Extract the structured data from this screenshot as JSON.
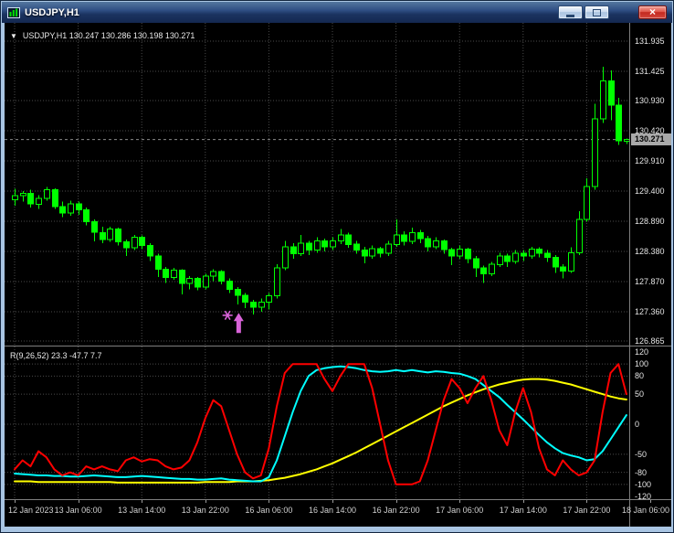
{
  "window": {
    "title": "USDJPY,H1",
    "close_glyph": "×"
  },
  "chart": {
    "dropdown_glyph": "▼",
    "symbol_line": "USDJPY,H1 130.247 130.286 130.198 130.271"
  },
  "chart_data": {
    "type": "candlestick",
    "symbol": "USDJPY",
    "timeframe": "H1",
    "style": {
      "background": "#000000",
      "candle": "#00ff00",
      "grid": "#4a4a4a",
      "separator": "#7f7f7f",
      "axis_text": "#e4e4e4",
      "bid_line": "#8a8a8a",
      "badge_bg": "#a9a9a9"
    },
    "price_axis": {
      "ticks": [
        "131.935",
        "131.425",
        "130.930",
        "130.420",
        "129.910",
        "129.400",
        "128.890",
        "128.380",
        "127.870",
        "127.360",
        "126.865"
      ],
      "current": "130.271"
    },
    "time_axis": {
      "labels": [
        "12 Jan 2023",
        "13 Jan 06:00",
        "13 Jan 14:00",
        "13 Jan 22:00",
        "16 Jan 06:00",
        "16 Jan 14:00",
        "16 Jan 22:00",
        "17 Jan 06:00",
        "17 Jan 14:00",
        "17 Jan 22:00",
        "18 Jan 06:00"
      ],
      "bar_index": [
        0,
        8,
        16,
        24,
        32,
        40,
        48,
        56,
        64,
        72,
        80
      ]
    },
    "candles": [
      [
        129.25,
        129.44,
        129.15,
        129.32
      ],
      [
        129.32,
        129.4,
        129.22,
        129.36
      ],
      [
        129.36,
        129.42,
        129.12,
        129.18
      ],
      [
        129.18,
        129.33,
        129.1,
        129.28
      ],
      [
        129.28,
        129.47,
        129.24,
        129.42
      ],
      [
        129.42,
        129.45,
        129.1,
        129.14
      ],
      [
        129.14,
        129.22,
        128.96,
        129.03
      ],
      [
        129.03,
        129.24,
        128.98,
        129.18
      ],
      [
        129.18,
        129.22,
        129.0,
        129.08
      ],
      [
        129.08,
        129.12,
        128.82,
        128.88
      ],
      [
        128.88,
        128.92,
        128.55,
        128.7
      ],
      [
        128.7,
        128.8,
        128.52,
        128.58
      ],
      [
        128.58,
        128.8,
        128.54,
        128.76
      ],
      [
        128.76,
        128.78,
        128.48,
        128.54
      ],
      [
        128.54,
        128.58,
        128.3,
        128.44
      ],
      [
        128.44,
        128.66,
        128.4,
        128.62
      ],
      [
        128.62,
        128.65,
        128.42,
        128.48
      ],
      [
        128.48,
        128.52,
        128.22,
        128.3
      ],
      [
        128.3,
        128.34,
        127.95,
        128.08
      ],
      [
        128.08,
        128.12,
        127.85,
        127.94
      ],
      [
        127.94,
        128.1,
        127.9,
        128.06
      ],
      [
        128.06,
        128.08,
        127.65,
        127.84
      ],
      [
        127.84,
        127.96,
        127.74,
        127.92
      ],
      [
        127.92,
        127.95,
        127.72,
        127.78
      ],
      [
        127.78,
        128.0,
        127.74,
        127.96
      ],
      [
        127.96,
        128.08,
        127.88,
        128.04
      ],
      [
        128.04,
        128.06,
        127.82,
        127.88
      ],
      [
        127.88,
        127.92,
        127.68,
        127.74
      ],
      [
        127.74,
        127.78,
        127.48,
        127.64
      ],
      [
        127.64,
        127.68,
        127.42,
        127.52
      ],
      [
        127.52,
        127.56,
        127.31,
        127.44
      ],
      [
        127.44,
        127.58,
        127.36,
        127.52
      ],
      [
        127.52,
        127.68,
        127.4,
        127.63
      ],
      [
        127.63,
        128.16,
        127.58,
        128.1
      ],
      [
        128.1,
        128.56,
        128.06,
        128.46
      ],
      [
        128.46,
        128.52,
        128.26,
        128.34
      ],
      [
        128.34,
        128.66,
        128.3,
        128.52
      ],
      [
        128.52,
        128.56,
        128.32,
        128.4
      ],
      [
        128.4,
        128.62,
        128.36,
        128.56
      ],
      [
        128.56,
        128.6,
        128.38,
        128.46
      ],
      [
        128.46,
        128.62,
        128.4,
        128.56
      ],
      [
        128.56,
        128.76,
        128.5,
        128.66
      ],
      [
        128.66,
        128.7,
        128.44,
        128.5
      ],
      [
        128.5,
        128.56,
        128.34,
        128.4
      ],
      [
        128.4,
        128.46,
        128.18,
        128.3
      ],
      [
        128.3,
        128.48,
        128.26,
        128.43
      ],
      [
        128.43,
        128.46,
        128.28,
        128.35
      ],
      [
        128.35,
        128.56,
        128.3,
        128.5
      ],
      [
        128.5,
        128.92,
        128.46,
        128.66
      ],
      [
        128.66,
        128.72,
        128.48,
        128.55
      ],
      [
        128.55,
        128.78,
        128.5,
        128.7
      ],
      [
        128.7,
        128.74,
        128.52,
        128.6
      ],
      [
        128.6,
        128.64,
        128.38,
        128.46
      ],
      [
        128.46,
        128.62,
        128.42,
        128.56
      ],
      [
        128.56,
        128.58,
        128.34,
        128.41
      ],
      [
        128.41,
        128.44,
        128.15,
        128.3
      ],
      [
        128.3,
        128.48,
        128.26,
        128.42
      ],
      [
        128.42,
        128.44,
        128.18,
        128.26
      ],
      [
        128.26,
        128.3,
        127.95,
        128.1
      ],
      [
        128.1,
        128.14,
        127.85,
        128.0
      ],
      [
        128.0,
        128.2,
        127.96,
        128.16
      ],
      [
        128.16,
        128.36,
        128.12,
        128.3
      ],
      [
        128.3,
        128.34,
        128.12,
        128.21
      ],
      [
        128.21,
        128.4,
        128.17,
        128.35
      ],
      [
        128.35,
        128.4,
        128.22,
        128.3
      ],
      [
        128.3,
        128.46,
        128.26,
        128.42
      ],
      [
        128.42,
        128.45,
        128.28,
        128.35
      ],
      [
        128.35,
        128.4,
        128.2,
        128.28
      ],
      [
        128.28,
        128.32,
        128.02,
        128.12
      ],
      [
        128.12,
        128.16,
        127.92,
        128.05
      ],
      [
        128.05,
        128.45,
        128.02,
        128.36
      ],
      [
        128.36,
        129.06,
        128.32,
        128.92
      ],
      [
        128.92,
        129.62,
        128.88,
        129.48
      ],
      [
        129.48,
        130.88,
        129.42,
        130.62
      ],
      [
        130.62,
        131.5,
        130.55,
        131.26
      ],
      [
        131.26,
        131.44,
        130.6,
        130.85
      ],
      [
        130.85,
        130.98,
        130.18,
        130.25
      ],
      [
        130.247,
        130.286,
        130.198,
        130.271
      ]
    ],
    "annotations": {
      "color": "#d863d8",
      "arrow": {
        "type": "arrow-up",
        "bar": 28.2,
        "price": 127.34
      },
      "star": {
        "type": "star",
        "bar": 26.8,
        "price": 127.3
      }
    },
    "indicator": {
      "label": "R(9,26,52) 23.3 -47.7 7.7",
      "axis_ticks": [
        "120",
        "100",
        "80",
        "50",
        "0",
        "-50",
        "-80",
        "-100",
        "-120"
      ],
      "range": [
        -120,
        120
      ],
      "levels": [
        100,
        80,
        50,
        0,
        -50,
        -80,
        -100
      ],
      "series": [
        {
          "name": "yellow",
          "color": "#ffff00",
          "values": [
            -95,
            -95,
            -95,
            -96,
            -96,
            -96,
            -96,
            -96,
            -96,
            -96,
            -96,
            -96,
            -96,
            -97,
            -97,
            -97,
            -97,
            -97,
            -97,
            -97,
            -97,
            -97,
            -97,
            -97,
            -96,
            -96,
            -96,
            -96,
            -95,
            -95,
            -95,
            -94,
            -93,
            -91,
            -89,
            -86,
            -83,
            -79,
            -75,
            -70,
            -65,
            -59,
            -53,
            -47,
            -40,
            -33,
            -26,
            -19,
            -12,
            -5,
            2,
            9,
            16,
            23,
            30,
            36,
            42,
            48,
            53,
            58,
            62,
            66,
            69,
            72,
            74,
            75,
            75,
            74,
            72,
            69,
            66,
            62,
            58,
            54,
            50,
            46,
            43,
            41
          ]
        },
        {
          "name": "cyan",
          "color": "#00ffff",
          "values": [
            -82,
            -83,
            -84,
            -85,
            -85,
            -86,
            -86,
            -87,
            -87,
            -86,
            -85,
            -86,
            -87,
            -88,
            -88,
            -87,
            -86,
            -87,
            -88,
            -89,
            -90,
            -91,
            -91,
            -92,
            -92,
            -91,
            -90,
            -92,
            -93,
            -94,
            -95,
            -95,
            -88,
            -60,
            -20,
            20,
            55,
            80,
            90,
            93,
            95,
            96,
            95,
            93,
            90,
            88,
            87,
            88,
            90,
            88,
            90,
            88,
            86,
            88,
            87,
            85,
            84,
            80,
            75,
            65,
            55,
            45,
            32,
            20,
            8,
            -5,
            -18,
            -30,
            -40,
            -48,
            -52,
            -55,
            -60,
            -58,
            -45,
            -25,
            -5,
            15
          ]
        },
        {
          "name": "red",
          "color": "#ff0000",
          "values": [
            -75,
            -60,
            -70,
            -45,
            -55,
            -75,
            -85,
            -80,
            -85,
            -70,
            -75,
            -70,
            -75,
            -78,
            -60,
            -55,
            -62,
            -58,
            -60,
            -70,
            -75,
            -72,
            -60,
            -30,
            10,
            40,
            30,
            -10,
            -50,
            -80,
            -90,
            -85,
            -40,
            30,
            85,
            100,
            100,
            100,
            100,
            75,
            55,
            80,
            100,
            100,
            100,
            60,
            0,
            -60,
            -100,
            -100,
            -100,
            -95,
            -60,
            -10,
            40,
            75,
            60,
            35,
            60,
            80,
            40,
            -10,
            -35,
            20,
            60,
            20,
            -40,
            -75,
            -85,
            -60,
            -75,
            -85,
            -80,
            -60,
            20,
            85,
            100,
            50
          ]
        }
      ]
    }
  }
}
